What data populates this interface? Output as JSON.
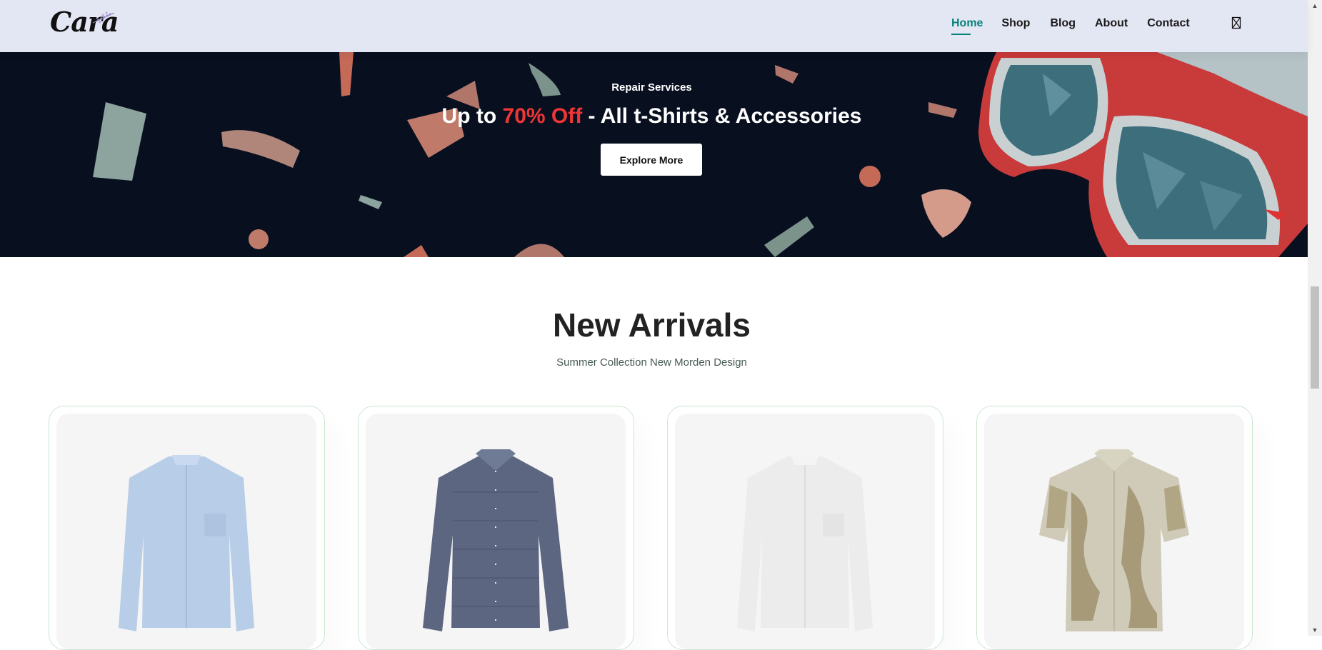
{
  "brand": {
    "logo_text": "Cara"
  },
  "nav": {
    "items": [
      {
        "label": "Home",
        "active": true
      },
      {
        "label": "Shop",
        "active": false
      },
      {
        "label": "Blog",
        "active": false
      },
      {
        "label": "About",
        "active": false
      },
      {
        "label": "Contact",
        "active": false
      }
    ],
    "cart_icon": "shopping-bag-icon"
  },
  "banner": {
    "subtitle": "Repair Services",
    "title_prefix": "Up to ",
    "title_highlight": "70% Off",
    "title_suffix": " - All t-Shirts & Accessories",
    "button_label": "Explore More"
  },
  "arrivals": {
    "title": "New Arrivals",
    "subtitle": "Summer Collection New Morden Design",
    "products": [
      {
        "image": "light-blue-shirt"
      },
      {
        "image": "navy-check-shirt"
      },
      {
        "image": "white-shirt"
      },
      {
        "image": "printed-short-sleeve-shirt"
      }
    ]
  },
  "colors": {
    "header_bg": "#e3e6f3",
    "accent": "#088178",
    "banner_bg": "#081020",
    "highlight": "#ef3636"
  }
}
